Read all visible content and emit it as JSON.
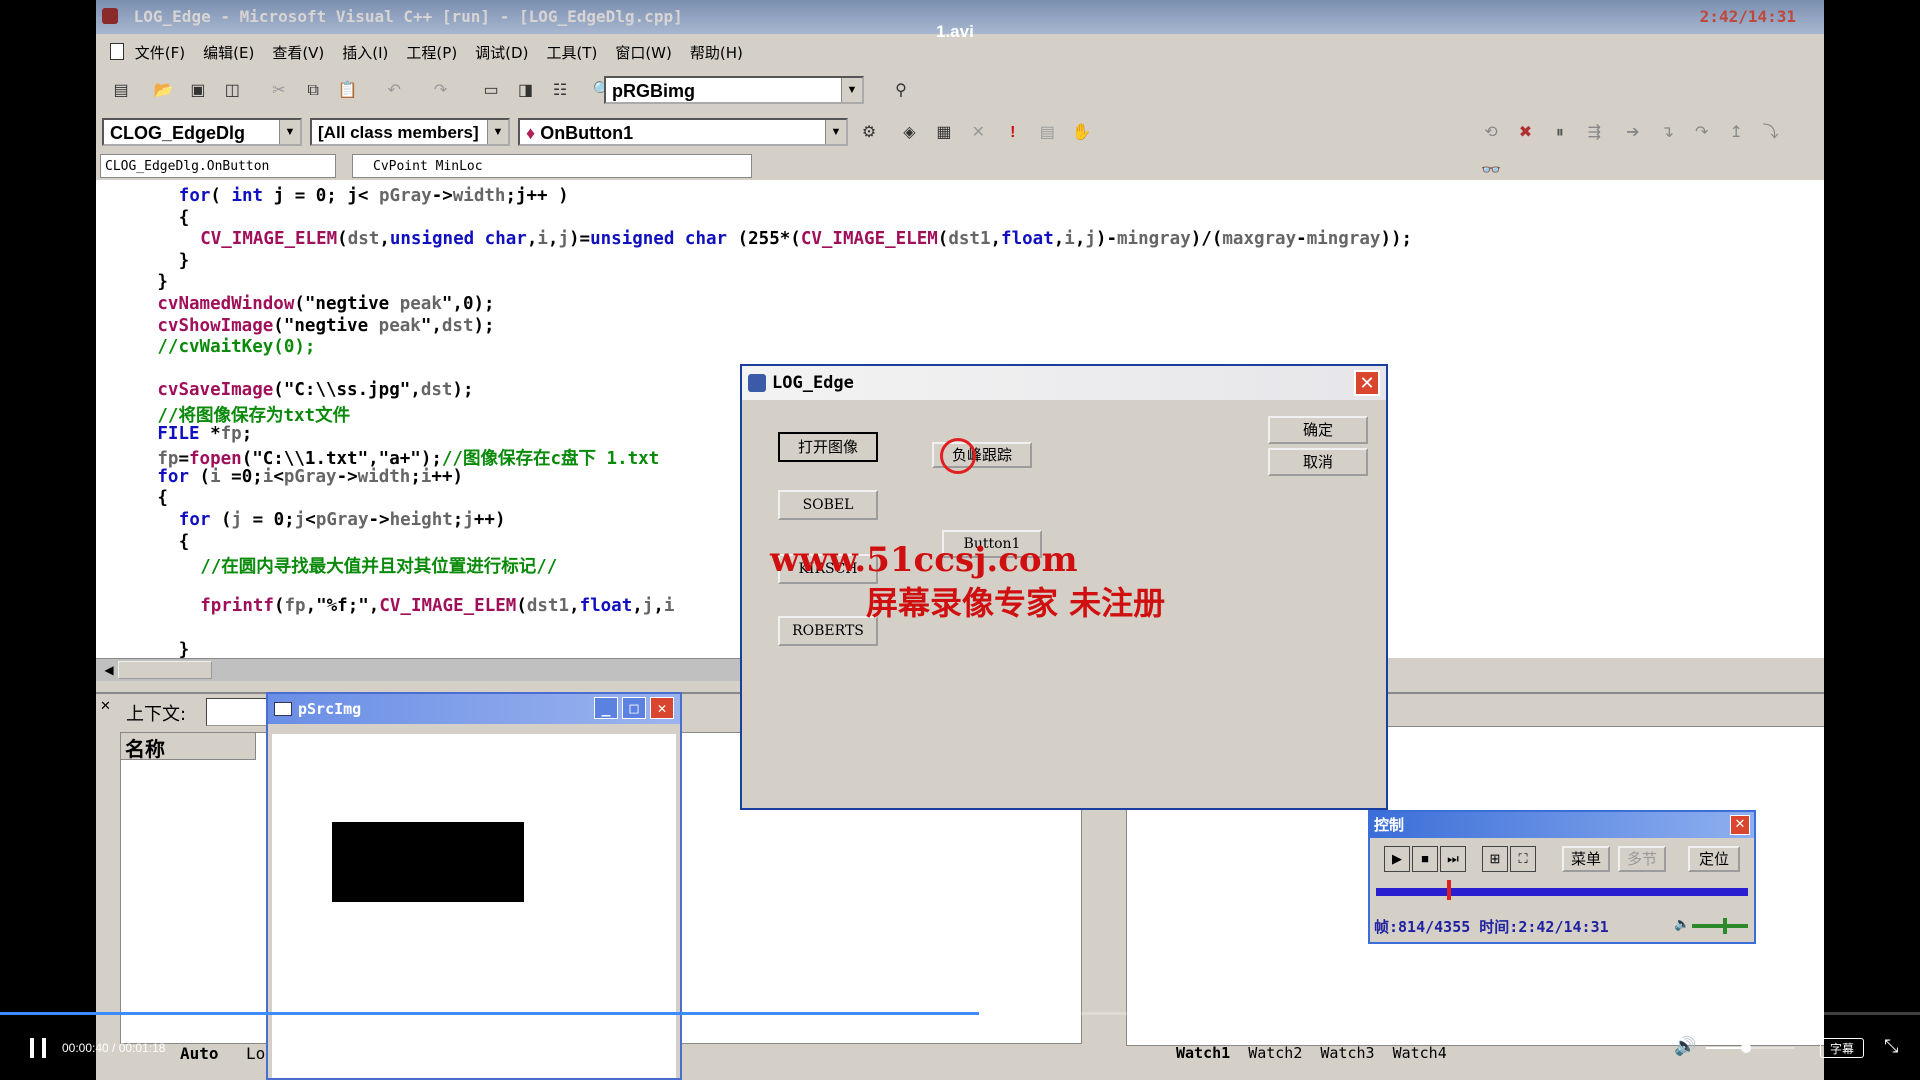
{
  "video": {
    "filename": "1.avi",
    "current_time": "00:00:40",
    "total_time": "00:01:18",
    "progress": 0.51,
    "volume": 0.45,
    "subtitle_label": "字幕",
    "time_sep": " / "
  },
  "ide": {
    "title": "LOG_Edge - Microsoft Visual C++ [run] - [LOG_EdgeDlg.cpp]",
    "overlay_clock": "2:42/14:31",
    "menu": [
      "文件(F)",
      "编辑(E)",
      "查看(V)",
      "插入(I)",
      "工程(P)",
      "调试(D)",
      "工具(T)",
      "窗口(W)",
      "帮助(H)"
    ],
    "toolbar_combo": "pRGBimg",
    "class_combo": "CLOG_EdgeDlg",
    "members_combo": "[All class members]",
    "function_combo": "OnButton1",
    "nav_left": "CLOG_EdgeDlg.OnButton",
    "nav_right": "CvPoint MinLoc",
    "code_lines": [
      {
        "indent": 4,
        "parts": [
          [
            "kw",
            "for"
          ],
          [
            "",
            "( "
          ],
          [
            "kw",
            "int"
          ],
          [
            "",
            " j = 0; j< "
          ],
          [
            "gr",
            "pGray"
          ],
          [
            "",
            "->"
          ],
          [
            "gr",
            "width"
          ],
          [
            "",
            ";j++ )"
          ]
        ]
      },
      {
        "indent": 4,
        "parts": [
          [
            "",
            "{"
          ]
        ]
      },
      {
        "indent": 6,
        "parts": [
          [
            "fn",
            "CV_IMAGE_ELEM"
          ],
          [
            "",
            "("
          ],
          [
            "gr",
            "dst"
          ],
          [
            "",
            ","
          ],
          [
            "kw",
            "unsigned char"
          ],
          [
            "",
            ","
          ],
          [
            "gr",
            "i"
          ],
          [
            "",
            ","
          ],
          [
            "gr",
            "j"
          ],
          [
            "",
            ")="
          ],
          [
            "kw",
            "unsigned char"
          ],
          [
            "",
            " (255*("
          ],
          [
            "fn",
            "CV_IMAGE_ELEM"
          ],
          [
            "",
            "("
          ],
          [
            "gr",
            "dst1"
          ],
          [
            "",
            ","
          ],
          [
            "kw",
            "float"
          ],
          [
            "",
            ","
          ],
          [
            "gr",
            "i"
          ],
          [
            "",
            ","
          ],
          [
            "gr",
            "j"
          ],
          [
            "",
            ")-"
          ],
          [
            "gr",
            "mingray"
          ],
          [
            "",
            ")/("
          ],
          [
            "gr",
            "maxgray"
          ],
          [
            "",
            "-"
          ],
          [
            "gr",
            "mingray"
          ],
          [
            "",
            "));"
          ]
        ]
      },
      {
        "indent": 4,
        "parts": [
          [
            "",
            "}"
          ]
        ]
      },
      {
        "indent": 2,
        "parts": [
          [
            "",
            "}"
          ]
        ]
      },
      {
        "indent": 2,
        "parts": [
          [
            "fn",
            "cvNamedWindow"
          ],
          [
            "",
            "(\"negtive "
          ],
          [
            "gr",
            "peak"
          ],
          [
            "",
            "\",0);"
          ]
        ]
      },
      {
        "indent": 2,
        "parts": [
          [
            "fn",
            "cvShowImage"
          ],
          [
            "",
            "(\"negtive "
          ],
          [
            "gr",
            "peak"
          ],
          [
            "",
            "\","
          ],
          [
            "gr",
            "dst"
          ],
          [
            "",
            ");"
          ]
        ]
      },
      {
        "indent": 2,
        "parts": [
          [
            "cm",
            "//cvWaitKey(0);"
          ]
        ]
      },
      {
        "indent": 2,
        "parts": [
          [
            "",
            ""
          ]
        ]
      },
      {
        "indent": 2,
        "parts": [
          [
            "fn",
            "cvSaveImage"
          ],
          [
            "",
            "(\"C:\\\\ss.jpg\","
          ],
          [
            "gr",
            "dst"
          ],
          [
            "",
            ");"
          ]
        ]
      },
      {
        "indent": 2,
        "parts": [
          [
            "cm",
            "//将图像保存为txt文件"
          ]
        ]
      },
      {
        "indent": 2,
        "parts": [
          [
            "kw",
            "FILE"
          ],
          [
            "",
            " *"
          ],
          [
            "gr",
            "fp"
          ],
          [
            "",
            ";"
          ]
        ]
      },
      {
        "indent": 2,
        "parts": [
          [
            "gr",
            "fp"
          ],
          [
            "",
            "="
          ],
          [
            "fn",
            "fopen"
          ],
          [
            "",
            "(\"C:\\\\1.txt\",\"a+\");"
          ],
          [
            "cm",
            "//图像保存在c盘下 1.txt"
          ]
        ]
      },
      {
        "indent": 2,
        "parts": [
          [
            "kw",
            "for"
          ],
          [
            "",
            " ("
          ],
          [
            "gr",
            "i"
          ],
          [
            "",
            " =0;"
          ],
          [
            "gr",
            "i"
          ],
          [
            "",
            "<"
          ],
          [
            "gr",
            "pGray"
          ],
          [
            "",
            "->"
          ],
          [
            "gr",
            "width"
          ],
          [
            "",
            ";"
          ],
          [
            "gr",
            "i"
          ],
          [
            "",
            "++)"
          ]
        ]
      },
      {
        "indent": 2,
        "parts": [
          [
            "",
            "{"
          ]
        ]
      },
      {
        "indent": 4,
        "parts": [
          [
            "kw",
            "for"
          ],
          [
            "",
            " ("
          ],
          [
            "gr",
            "j"
          ],
          [
            "",
            " = 0;"
          ],
          [
            "gr",
            "j"
          ],
          [
            "",
            "<"
          ],
          [
            "gr",
            "pGray"
          ],
          [
            "",
            "->"
          ],
          [
            "gr",
            "height"
          ],
          [
            "",
            ";"
          ],
          [
            "gr",
            "j"
          ],
          [
            "",
            "++)"
          ]
        ]
      },
      {
        "indent": 4,
        "parts": [
          [
            "",
            "{"
          ]
        ]
      },
      {
        "indent": 6,
        "parts": [
          [
            "cm",
            "//在圆内寻找最大值并且对其位置进行标记//"
          ]
        ]
      },
      {
        "indent": 6,
        "parts": [
          [
            "",
            ""
          ]
        ]
      },
      {
        "indent": 6,
        "parts": [
          [
            "fn",
            "fprintf"
          ],
          [
            "",
            "("
          ],
          [
            "gr",
            "fp"
          ],
          [
            "",
            ",\"%f;\","
          ],
          [
            "fn",
            "CV_IMAGE_ELEM"
          ],
          [
            "",
            "("
          ],
          [
            "gr",
            "dst1"
          ],
          [
            "",
            ","
          ],
          [
            "kw",
            "float"
          ],
          [
            "",
            ","
          ],
          [
            "gr",
            "j"
          ],
          [
            "",
            ","
          ],
          [
            "gr",
            "i"
          ]
        ]
      },
      {
        "indent": 6,
        "parts": [
          [
            "",
            ""
          ]
        ]
      },
      {
        "indent": 4,
        "parts": [
          [
            "",
            "}"
          ]
        ]
      }
    ],
    "context_label": "上下文:",
    "name_header": "名称",
    "auto_tab": "Auto",
    "locals_tab": "Lo",
    "watch_tabs": [
      "Watch1",
      "Watch2",
      "Watch3",
      "Watch4"
    ]
  },
  "src_window": {
    "title": "pSrcImg"
  },
  "log_dialog": {
    "title": "LOG_Edge",
    "buttons": {
      "open": "打开图像",
      "track": "负峰跟踪",
      "sobel": "SOBEL",
      "button1": "Button1",
      "hidden": "KIRSCH",
      "roberts": "ROBERTS",
      "ok": "确定",
      "cancel": "取消"
    }
  },
  "watermark": {
    "line1": "www.51ccsj.com",
    "line2": "屏幕录像专家 未注册"
  },
  "control_panel": {
    "title": "控制",
    "menu": "菜单",
    "step": "多节",
    "locate": "定位",
    "status": "帧:814/4355 时间:2:42/14:31",
    "progress": 0.19,
    "volume": 0.55
  }
}
